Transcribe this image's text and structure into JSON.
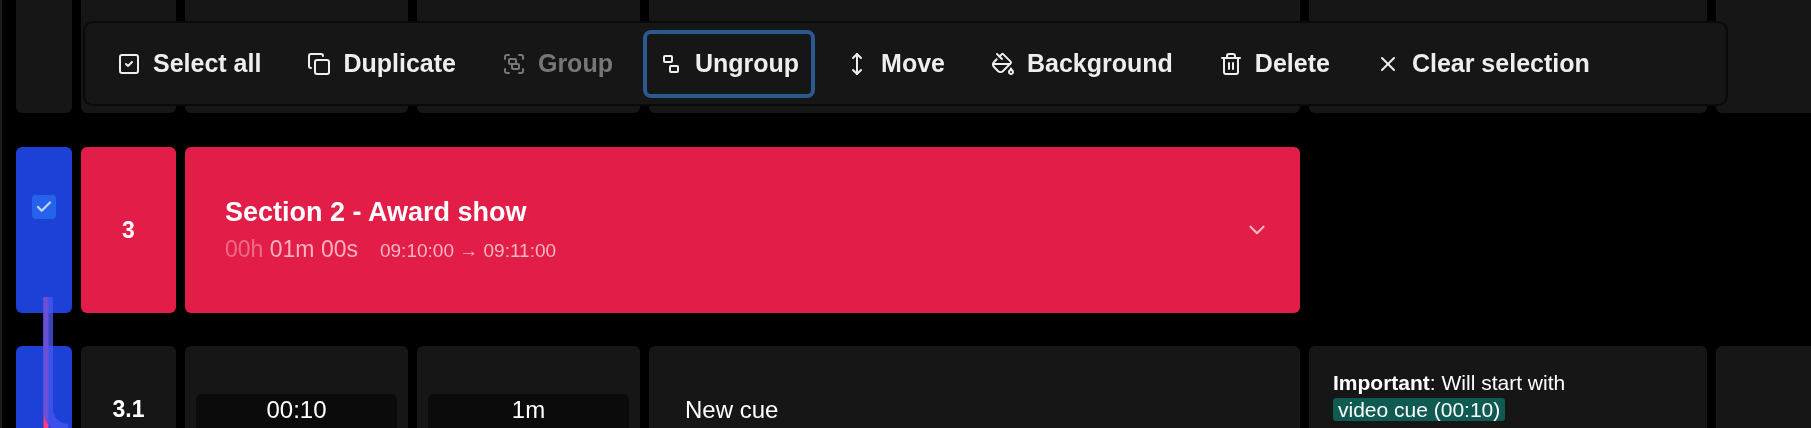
{
  "toolbar": {
    "actions": [
      {
        "label": "Select all",
        "kind": "select-all",
        "disabled": false,
        "focused": false
      },
      {
        "label": "Duplicate",
        "kind": "duplicate",
        "disabled": false,
        "focused": false
      },
      {
        "label": "Group",
        "kind": "group",
        "disabled": true,
        "focused": false
      },
      {
        "label": "Ungroup",
        "kind": "ungroup",
        "disabled": false,
        "focused": true
      },
      {
        "label": "Move",
        "kind": "move",
        "disabled": false,
        "focused": false
      },
      {
        "label": "Background",
        "kind": "background",
        "disabled": false,
        "focused": false
      },
      {
        "label": "Delete",
        "kind": "delete",
        "disabled": false,
        "focused": false
      },
      {
        "label": "Clear selection",
        "kind": "clear",
        "disabled": false,
        "focused": false
      }
    ]
  },
  "section": {
    "selected": true,
    "number": "3",
    "title": "Section 2 - Award show",
    "duration_hours": "00h",
    "duration_rest": "01m 00s",
    "time_range": "09:10:00 → 09:11:00",
    "expanded": false,
    "color": "#e11d48"
  },
  "cue": {
    "selected": true,
    "number": "3.1",
    "start": "00:10",
    "duration": "1m",
    "title": "New cue",
    "note": "**Important**: Will start with",
    "note_tag": "video cue (00:10)"
  }
}
